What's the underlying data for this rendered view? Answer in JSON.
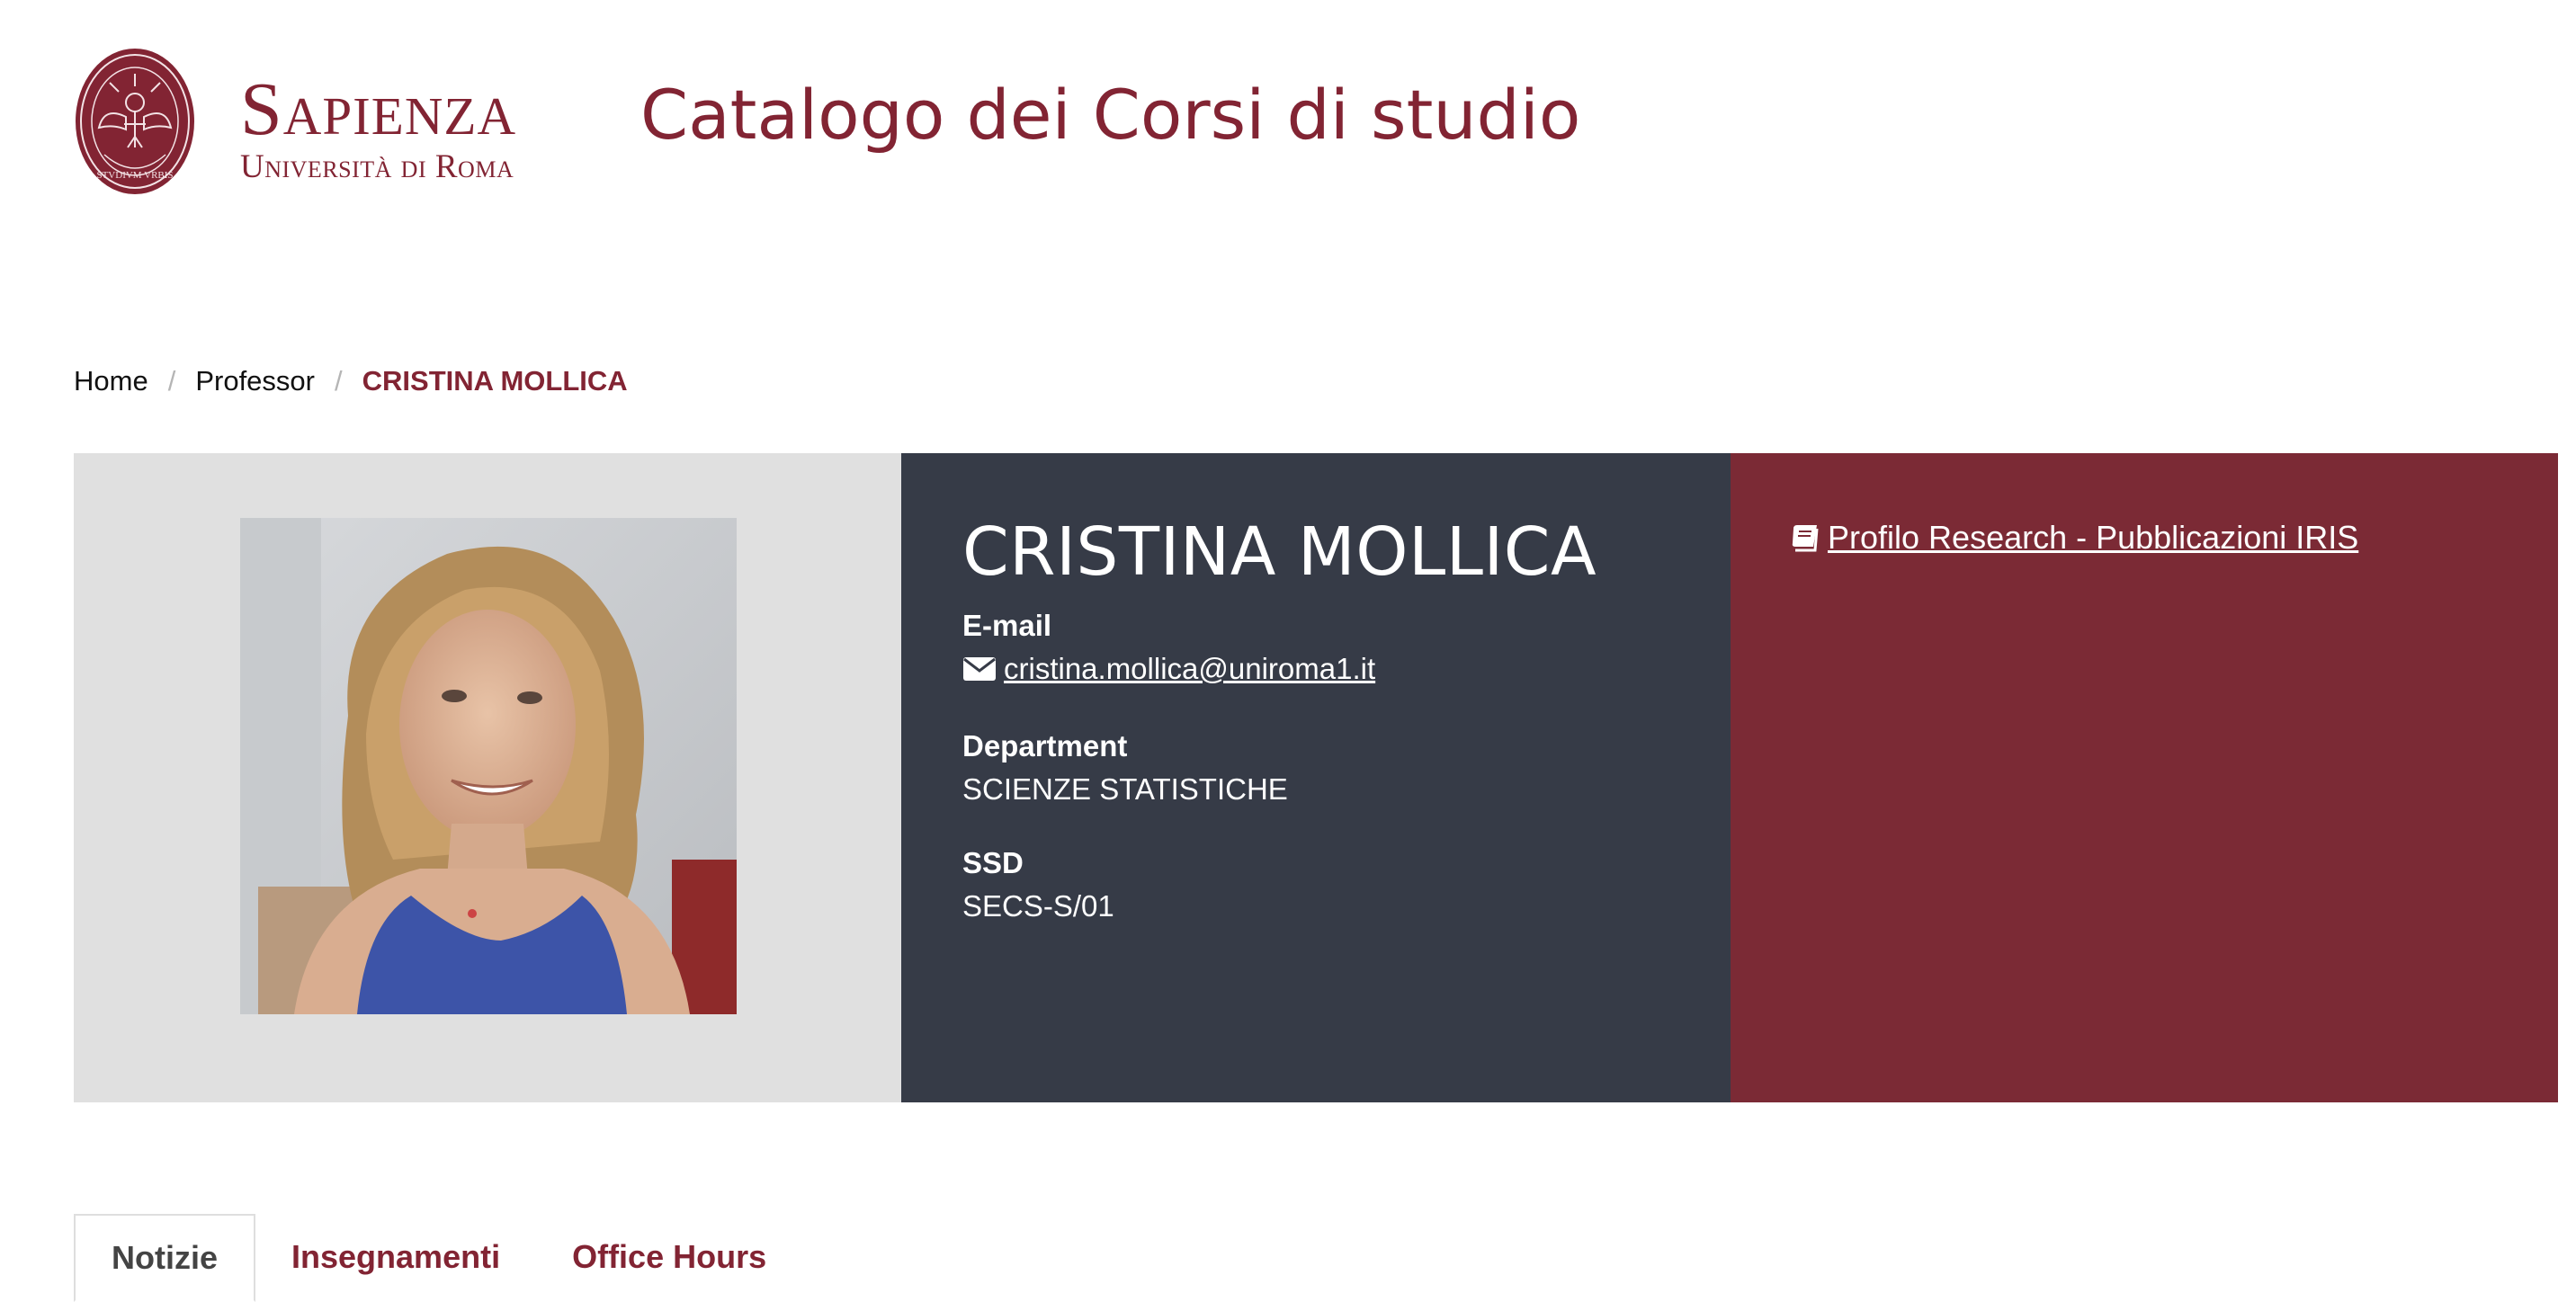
{
  "header": {
    "logo_wordmark": "Sapienza",
    "logo_subtitle": "Università di Roma",
    "logo_seal_text": "STVDIVM VRBIS",
    "site_title": "Catalogo dei Corsi di studio"
  },
  "breadcrumb": {
    "items": [
      "Home",
      "Professor"
    ],
    "current": "CRISTINA MOLLICA"
  },
  "profile": {
    "name": "CRISTINA MOLLICA",
    "email_label": "E-mail",
    "email": "cristina.mollica@uniroma1.it",
    "department_label": "Department",
    "department": "SCIENZE STATISTICHE",
    "ssd_label": "SSD",
    "ssd": "SECS-S/01",
    "iris_link": "Profilo Research - Pubblicazioni IRIS"
  },
  "tabs": [
    {
      "label": "Notizie",
      "active": true
    },
    {
      "label": "Insegnamenti",
      "active": false
    },
    {
      "label": "Office Hours",
      "active": false
    }
  ],
  "colors": {
    "brand": "#822433",
    "info_panel": "#363b47",
    "links_panel": "#7b2a35",
    "photo_panel": "#e0e0e0"
  },
  "icons": [
    "envelope-icon",
    "book-icon",
    "sapienza-seal-logo"
  ]
}
